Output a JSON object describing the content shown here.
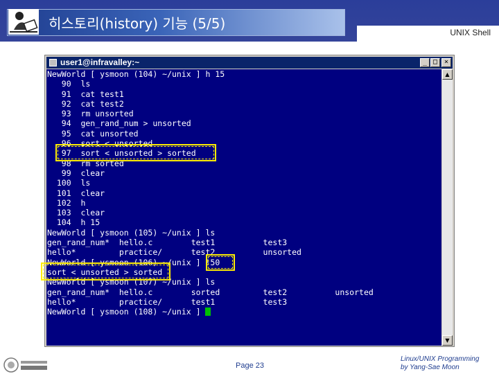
{
  "header": {
    "title": "히스토리(history) 기능 (5/5)",
    "right_label": "UNIX Shell"
  },
  "window": {
    "title": "user1@infravalley:~",
    "min_label": "_",
    "max_label": "□",
    "close_label": "×"
  },
  "terminal": {
    "lines": [
      "NewWorld [ ysmoon (104) ~/unix ] h 15",
      "   90  ls",
      "   91  cat test1",
      "   92  cat test2",
      "   93  rm unsorted",
      "   94  gen_rand_num > unsorted",
      "   95  cat unsorted",
      "   96  sort < unsorted",
      "   97  sort < unsorted > sorted",
      "   98  rm sorted",
      "   99  clear",
      "  100  ls",
      "  101  clear",
      "  102  h",
      "  103  clear",
      "  104  h 15",
      "NewWorld [ ysmoon (105) ~/unix ] ls",
      "gen_rand_num*  hello.c        test1          test3",
      "hello*         practice/      test2          unsorted",
      "NewWorld [ ysmoon (106) ~/unix ] !50",
      "sort < unsorted > sorted",
      "NewWorld [ ysmoon (107) ~/unix ] ls",
      "gen_rand_num*  hello.c        sorted         test2          unsorted",
      "hello*         practice/      test1          test3",
      "NewWorld [ ysmoon (108) ~/unix ] "
    ]
  },
  "footer": {
    "page": "Page 23",
    "course_line1": "Linux/UNIX Programming",
    "course_line2": "by Yang-Sae Moon"
  }
}
